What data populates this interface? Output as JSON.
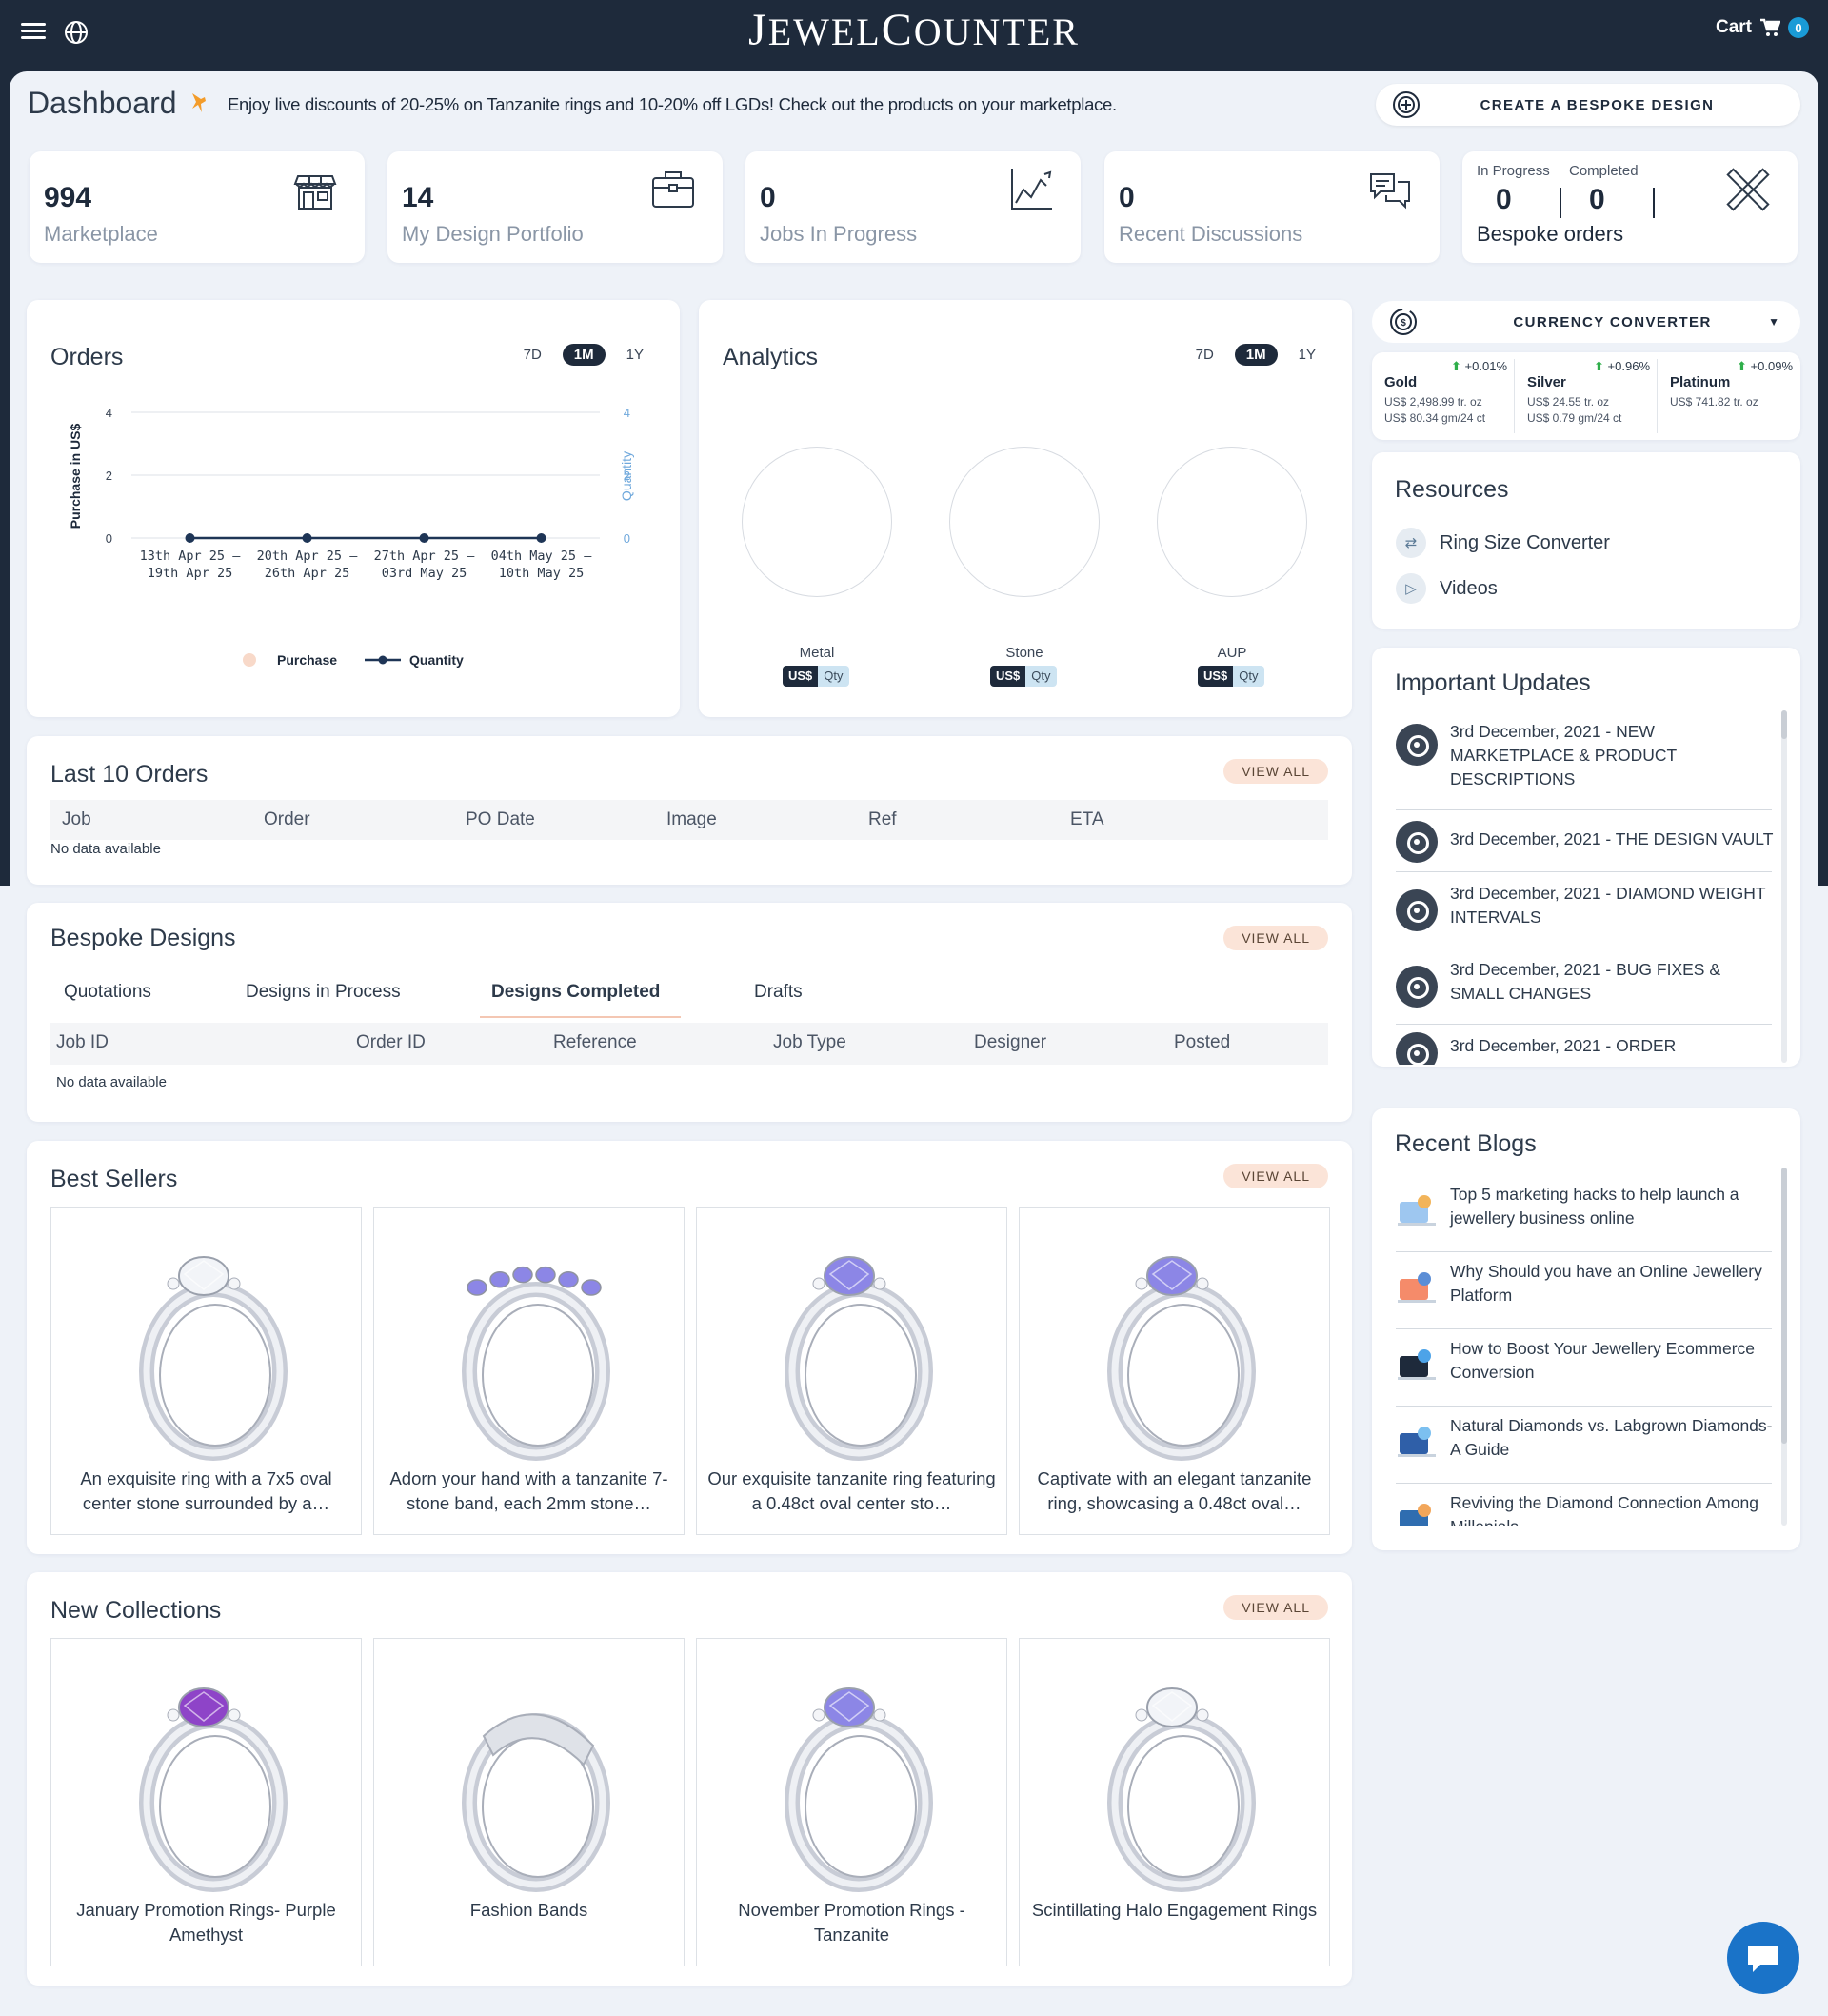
{
  "header": {
    "logo": "JewelCounter",
    "logo_first": "J",
    "logo_rest1": "EWEL",
    "logo_c": "C",
    "logo_rest2": "OUNTER",
    "cart_label": "Cart",
    "cart_count": "0"
  },
  "dashboard": {
    "title": "Dashboard",
    "promo": "Enjoy live discounts of 20-25% on Tanzanite rings and 10-20% off LGDs! Check out the products on your marketplace.",
    "bespoke_button": "CREATE A BESPOKE DESIGN"
  },
  "stats": [
    {
      "value": "994",
      "label": "Marketplace",
      "icon": "storefront-icon"
    },
    {
      "value": "14",
      "label": "My Design Portfolio",
      "icon": "briefcase-icon"
    },
    {
      "value": "0",
      "label": "Jobs In Progress",
      "icon": "line-chart-icon"
    },
    {
      "value": "0",
      "label": "Recent Discussions",
      "icon": "chat-bubbles-icon"
    }
  ],
  "bespoke_orders": {
    "in_progress_label": "In Progress",
    "in_progress": "0",
    "completed_label": "Completed",
    "completed": "0",
    "label": "Bespoke orders",
    "icon": "design-tools-icon"
  },
  "orders": {
    "title": "Orders",
    "ranges": [
      "7D",
      "1M",
      "1Y"
    ],
    "selected_range": "1M",
    "chart_data": {
      "type": "line",
      "categories": [
        "13th Apr 25 - 19th Apr 25",
        "20th Apr 25 - 26th Apr 25",
        "27th Apr 25 - 03rd May 25",
        "04th May 25 - 10th May 25"
      ],
      "cat_line1": [
        "13th Apr 25 –",
        "20th Apr 25 –",
        "27th Apr 25 –",
        "04th May 25 –"
      ],
      "cat_line2": [
        "19th Apr 25",
        "26th Apr 25",
        "03rd May 25",
        "10th May 25"
      ],
      "series": [
        {
          "name": "Purchase",
          "values": [
            0,
            0,
            0,
            0
          ],
          "color": "#f8d9c9"
        },
        {
          "name": "Quantity",
          "values": [
            0,
            0,
            0,
            0
          ],
          "color": "#1e3556"
        }
      ],
      "ylabel": "Purchase in US$",
      "y2label": "Quantity",
      "ylim": [
        0,
        4
      ],
      "yticks": [
        0,
        2,
        4
      ],
      "y2ticks": [
        0,
        2,
        4
      ],
      "grid": true,
      "legend": "bottom"
    }
  },
  "analytics": {
    "title": "Analytics",
    "ranges": [
      "7D",
      "1M",
      "1Y"
    ],
    "selected_range": "1M",
    "items": [
      {
        "label": "Metal",
        "unit1": "US$",
        "unit2": "Qty"
      },
      {
        "label": "Stone",
        "unit1": "US$",
        "unit2": "Qty"
      },
      {
        "label": "AUP",
        "unit1": "US$",
        "unit2": "Qty"
      }
    ]
  },
  "last_orders": {
    "title": "Last 10 Orders",
    "view_all": "VIEW ALL",
    "columns": [
      "Job",
      "Order",
      "PO Date",
      "Image",
      "Ref",
      "ETA"
    ],
    "empty": "No data available"
  },
  "bespoke_designs": {
    "title": "Bespoke Designs",
    "view_all": "VIEW ALL",
    "tabs": [
      "Quotations",
      "Designs in Process",
      "Designs Completed",
      "Drafts"
    ],
    "active_tab": "Designs Completed",
    "columns": [
      "Job ID",
      "Order ID",
      "Reference",
      "Job Type",
      "Designer",
      "Posted"
    ],
    "empty": "No data available"
  },
  "best_sellers": {
    "title": "Best Sellers",
    "view_all": "VIEW ALL",
    "items": [
      {
        "text": "An exquisite ring with a 7x5 oval center stone surrounded by a…",
        "stone": "#f2f4f8"
      },
      {
        "text": "Adorn your hand with a tanzanite 7-stone band, each 2mm stone…",
        "stone": "#8c86e6"
      },
      {
        "text": "Our exquisite tanzanite ring featuring a 0.48ct oval center sto…",
        "stone": "#8c86e6"
      },
      {
        "text": "Captivate with an elegant tanzanite ring, showcasing a 0.48ct oval…",
        "stone": "#8c86e6"
      }
    ]
  },
  "new_collections": {
    "title": "New Collections",
    "view_all": "VIEW ALL",
    "items": [
      {
        "text": "January Promotion Rings- Purple Amethyst",
        "stone": "#8e44c8"
      },
      {
        "text": "Fashion Bands",
        "stone": ""
      },
      {
        "text": "November Promotion Rings - Tanzanite",
        "stone": "#8c86e6"
      },
      {
        "text": "Scintillating Halo Engagement Rings",
        "stone": "#f2f4f8"
      }
    ]
  },
  "currency": {
    "title": "CURRENCY CONVERTER",
    "metals": [
      {
        "name": "Gold",
        "change": "+0.01%",
        "price1": "US$ 2,498.99 tr. oz",
        "price2": "US$ 80.34 gm/24 ct"
      },
      {
        "name": "Silver",
        "change": "+0.96%",
        "price1": "US$ 24.55 tr. oz",
        "price2": "US$ 0.79 gm/24 ct"
      },
      {
        "name": "Platinum",
        "change": "+0.09%",
        "price1": "US$ 741.82 tr. oz",
        "price2": ""
      }
    ]
  },
  "resources": {
    "title": "Resources",
    "items": [
      "Ring Size Converter",
      "Videos"
    ]
  },
  "updates": {
    "title": "Important Updates",
    "items": [
      "3rd December, 2021 - NEW MARKETPLACE & PRODUCT DESCRIPTIONS",
      "3rd December, 2021 - THE DESIGN VAULT",
      "3rd December, 2021 - DIAMOND WEIGHT INTERVALS",
      "3rd December, 2021 - BUG FIXES & SMALL CHANGES",
      "3rd December, 2021 - ORDER"
    ]
  },
  "blogs": {
    "title": "Recent Blogs",
    "items": [
      "Top 5 marketing hacks to help launch a jewellery business online",
      "Why Should you have an Online Jewellery Platform",
      "How to Boost Your Jewellery Ecommerce Conversion",
      "Natural Diamonds vs. Labgrown Diamonds- A Guide",
      "Reviving the Diamond Connection Among Millenials"
    ]
  }
}
